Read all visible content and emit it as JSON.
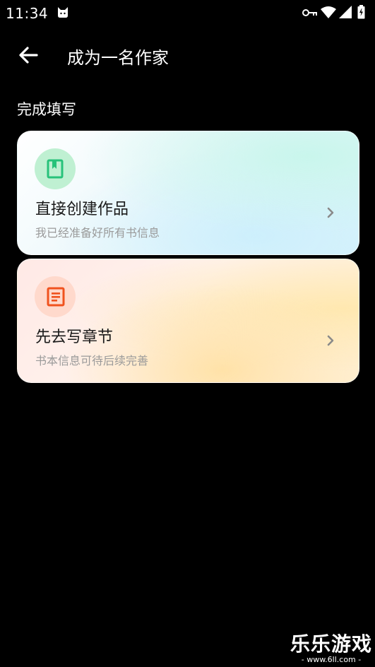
{
  "status_bar": {
    "time": "11:34",
    "icons": [
      "cat-icon",
      "key-icon",
      "wifi-icon",
      "signal-icon",
      "battery-icon"
    ]
  },
  "app_bar": {
    "back_icon": "arrow-left-icon",
    "title": "成为一名作家"
  },
  "section": {
    "label": "完成填写"
  },
  "options": [
    {
      "icon": "bookmark-book-icon",
      "accent": "#27c27a",
      "title": "直接创建作品",
      "subtitle": "我已经准备好所有书信息"
    },
    {
      "icon": "document-lines-icon",
      "accent": "#f0521e",
      "title": "先去写章节",
      "subtitle": "书本信息可待后续完善"
    }
  ],
  "watermark": {
    "big": "乐乐游戏",
    "small": "- www.6ll.com -"
  }
}
